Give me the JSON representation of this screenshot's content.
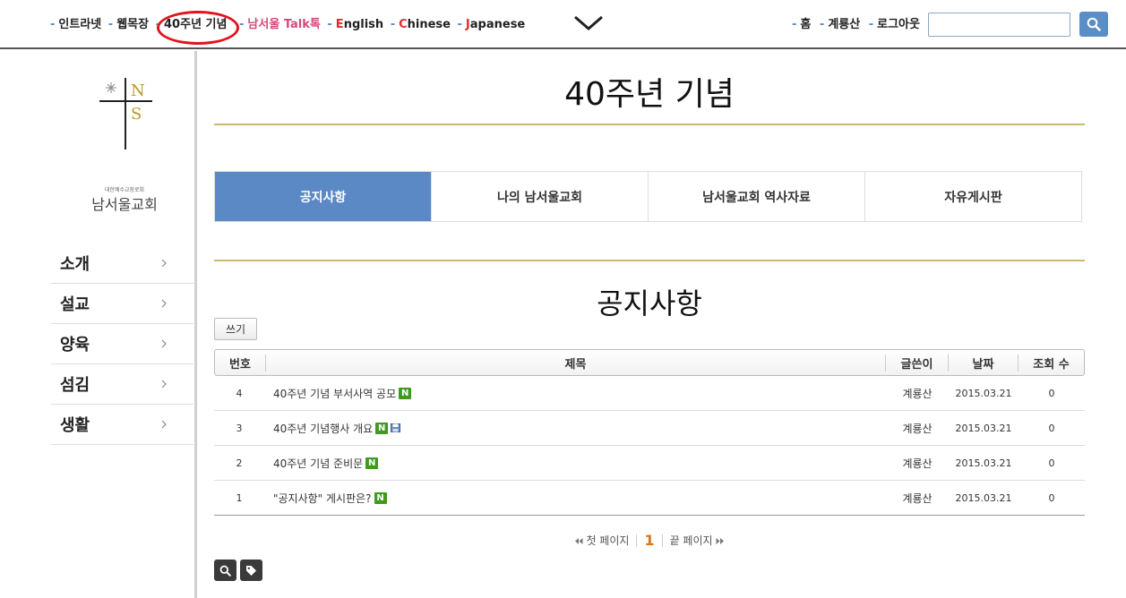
{
  "topnav": {
    "links": [
      {
        "label": "인트라넷",
        "style": "normal"
      },
      {
        "label": "웹목장",
        "style": "normal"
      },
      {
        "label": "40주년 기념",
        "style": "highlight"
      },
      {
        "label": "남서울 Talk톡",
        "style": "pink"
      },
      {
        "label_prefix": "E",
        "label_rest": "nglish",
        "style": "lang"
      },
      {
        "label_prefix": "C",
        "label_rest": "hinese",
        "style": "lang"
      },
      {
        "label_prefix": "J",
        "label_rest": "apanese",
        "style": "lang"
      }
    ],
    "dash": "-",
    "chevron_icon": "chevron-down-icon",
    "right_links": [
      {
        "label": "홈"
      },
      {
        "label": "계룡산"
      },
      {
        "label": "로그아웃"
      }
    ],
    "search_placeholder": "",
    "search_icon": "search-icon"
  },
  "sidebar": {
    "logo": {
      "letters": "NS",
      "sub": "대한예수교장로회",
      "name": "남서울교회"
    },
    "menu": [
      {
        "label": "소개"
      },
      {
        "label": "설교"
      },
      {
        "label": "양육"
      },
      {
        "label": "섬김"
      },
      {
        "label": "생활"
      }
    ]
  },
  "main": {
    "title": "40주년 기념",
    "tabs": [
      {
        "label": "공지사항",
        "active": true
      },
      {
        "label": "나의 남서울교회",
        "active": false
      },
      {
        "label": "남서울교회 역사자료",
        "active": false
      },
      {
        "label": "자유게시판",
        "active": false
      }
    ],
    "board_title": "공지사항",
    "write_label": "쓰기",
    "columns": {
      "num": "번호",
      "title": "제목",
      "author": "글쓴이",
      "date": "날짜",
      "views": "조회 수"
    },
    "rows": [
      {
        "num": "4",
        "title": "40주년 기념 부서사역 공모",
        "new": true,
        "file": false,
        "author": "계룡산",
        "date": "2015.03.21",
        "views": "0"
      },
      {
        "num": "3",
        "title": "40주년 기념행사 개요",
        "new": true,
        "file": true,
        "author": "계룡산",
        "date": "2015.03.21",
        "views": "0"
      },
      {
        "num": "2",
        "title": "40주년 기념 준비문",
        "new": true,
        "file": false,
        "author": "계룡산",
        "date": "2015.03.21",
        "views": "0"
      },
      {
        "num": "1",
        "title": "\"공지사항\" 게시판은?",
        "new": true,
        "file": false,
        "author": "계룡산",
        "date": "2015.03.21",
        "views": "0"
      }
    ],
    "new_badge": "N",
    "pager": {
      "first": "첫 페이지",
      "current": "1",
      "last": "끝 페이지"
    },
    "colors": {
      "accent": "#5a89c5",
      "gold": "#c9b873",
      "new_badge": "#3f9a1e",
      "highlight_circle": "#e0141c"
    }
  }
}
